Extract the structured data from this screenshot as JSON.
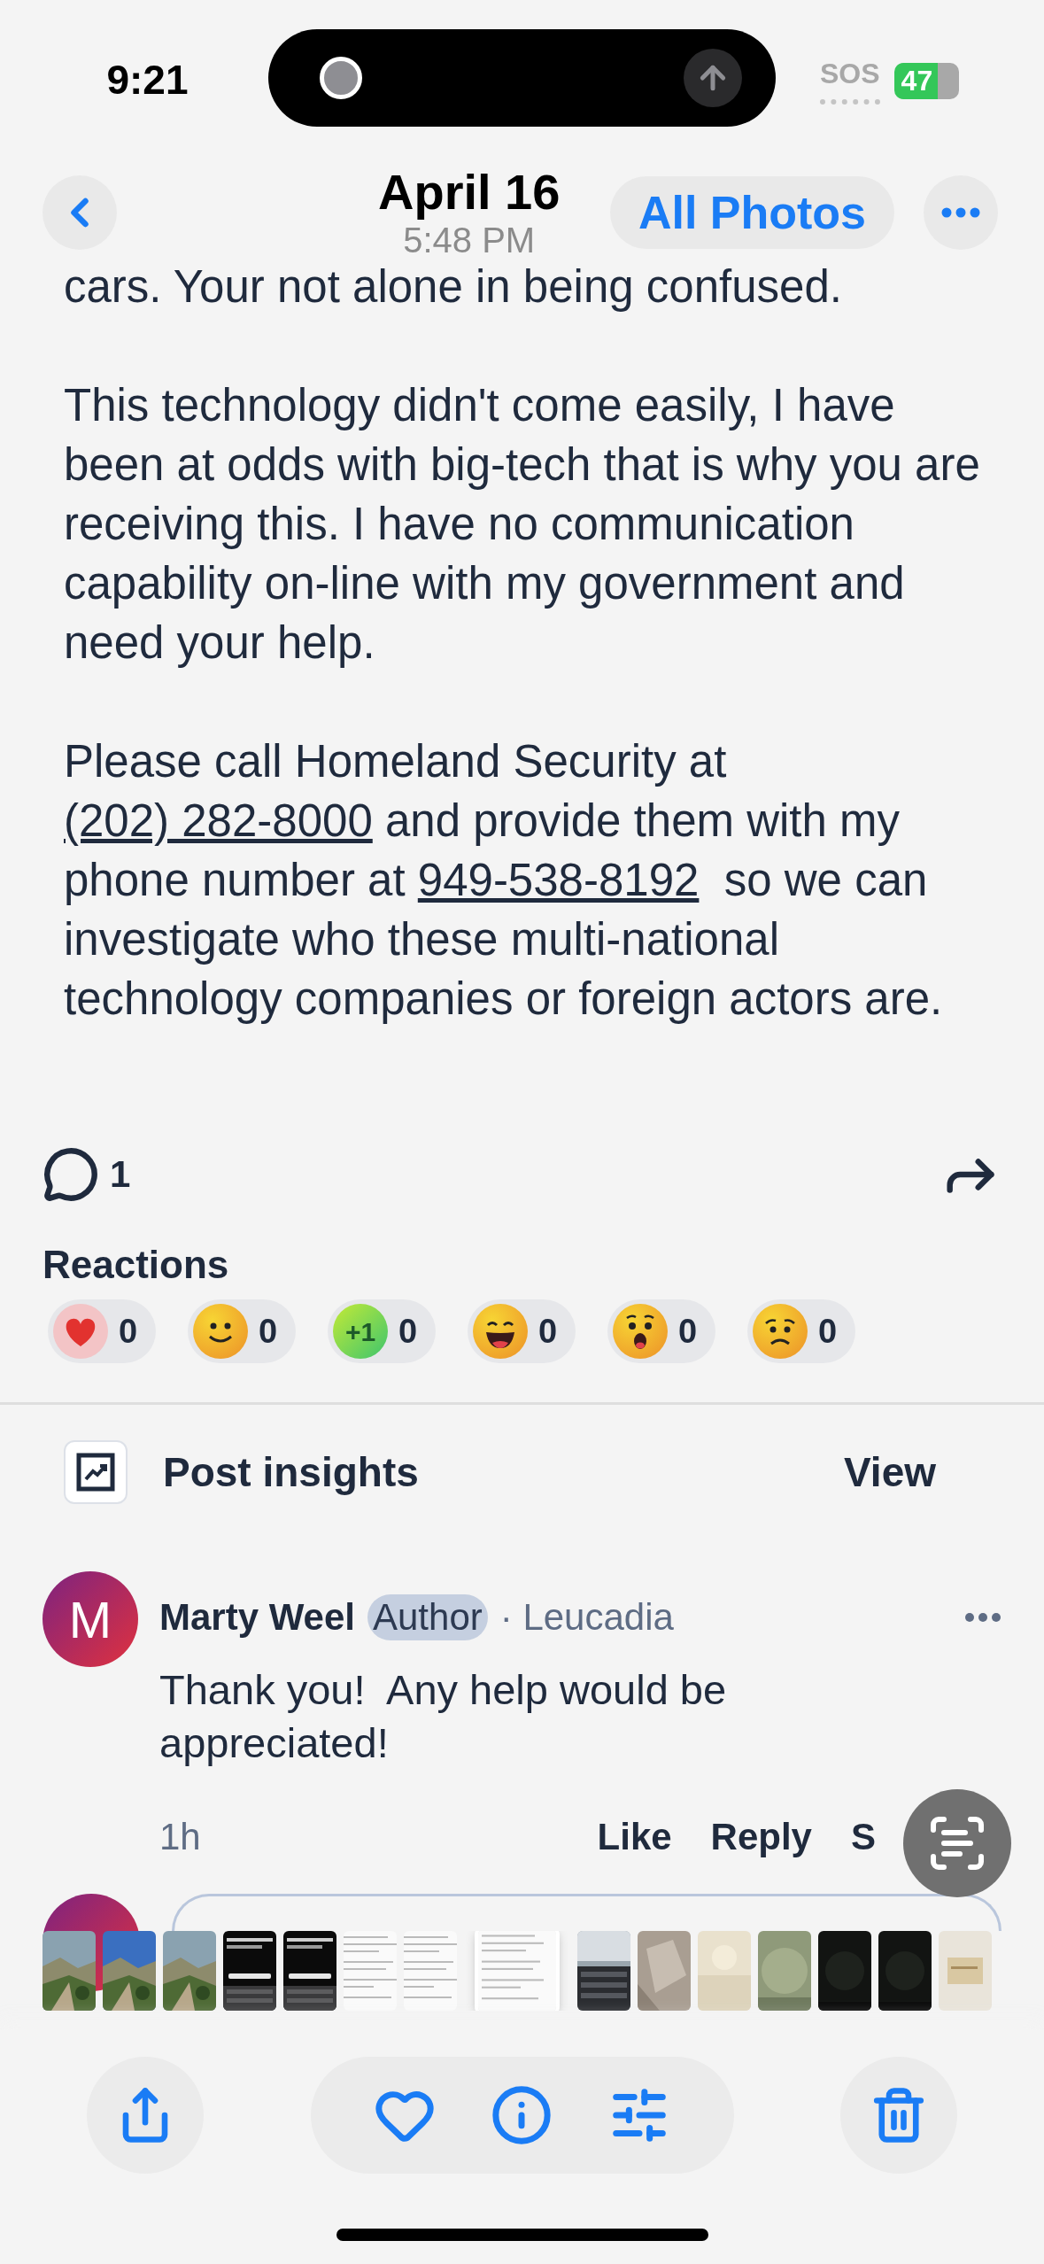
{
  "status_bar": {
    "time": "9:21",
    "carrier": "SOS",
    "battery": "47"
  },
  "nav": {
    "title": "April 16",
    "subtitle": "5:48 PM",
    "all_photos": "All Photos"
  },
  "post": {
    "cut_line": "cars. Your not alone in being confused.",
    "paragraphs": [
      [
        {
          "kind": "text",
          "text": "This technology didn't come easily, I have been at odds with big-tech that is why you are receiving this. I have no communication capability on-line with my government and need your help."
        }
      ],
      [
        {
          "kind": "text",
          "text": "Please call Homeland Security at "
        },
        {
          "kind": "link",
          "text": "(202) 282-8000"
        },
        {
          "kind": "text",
          "text": " and provide them with my phone number at "
        },
        {
          "kind": "link",
          "text": "949-538-8192"
        },
        {
          "kind": "text",
          "text": "  so we can investigate who these multi-national technology companies or foreign actors are."
        }
      ]
    ]
  },
  "comment_count": "1",
  "reactions": {
    "title": "Reactions",
    "items": [
      {
        "kind": "heart",
        "count": "0"
      },
      {
        "kind": "smile",
        "count": "0"
      },
      {
        "kind": "plus-one",
        "badge": "+1",
        "count": "0"
      },
      {
        "kind": "grin",
        "count": "0"
      },
      {
        "kind": "wow",
        "count": "0"
      },
      {
        "kind": "sad",
        "count": "0"
      }
    ]
  },
  "insights": {
    "label": "Post insights",
    "action": "View"
  },
  "comment": {
    "initial": "M",
    "author": "Marty Weel",
    "badge": "Author",
    "location": "· Leucadia",
    "text": "Thank you!  Any help would be appreciated!",
    "time": "1h",
    "actions": [
      "Like",
      "Reply",
      "S"
    ]
  },
  "filmstrip": [
    {
      "kind": "picture",
      "selected": false
    },
    {
      "kind": "picture",
      "selected": false
    },
    {
      "kind": "picture",
      "selected": false
    },
    {
      "kind": "picture",
      "selected": false
    },
    {
      "kind": "picture",
      "selected": false
    },
    {
      "kind": "picture",
      "selected": false
    },
    {
      "kind": "picture",
      "selected": false
    },
    {
      "kind": "picture",
      "selected": true
    },
    {
      "kind": "picture",
      "selected": false
    },
    {
      "kind": "picture",
      "selected": false
    },
    {
      "kind": "picture",
      "selected": false
    },
    {
      "kind": "picture",
      "selected": false
    },
    {
      "kind": "picture",
      "selected": false
    },
    {
      "kind": "picture",
      "selected": false
    },
    {
      "kind": "picture",
      "selected": false
    }
  ]
}
